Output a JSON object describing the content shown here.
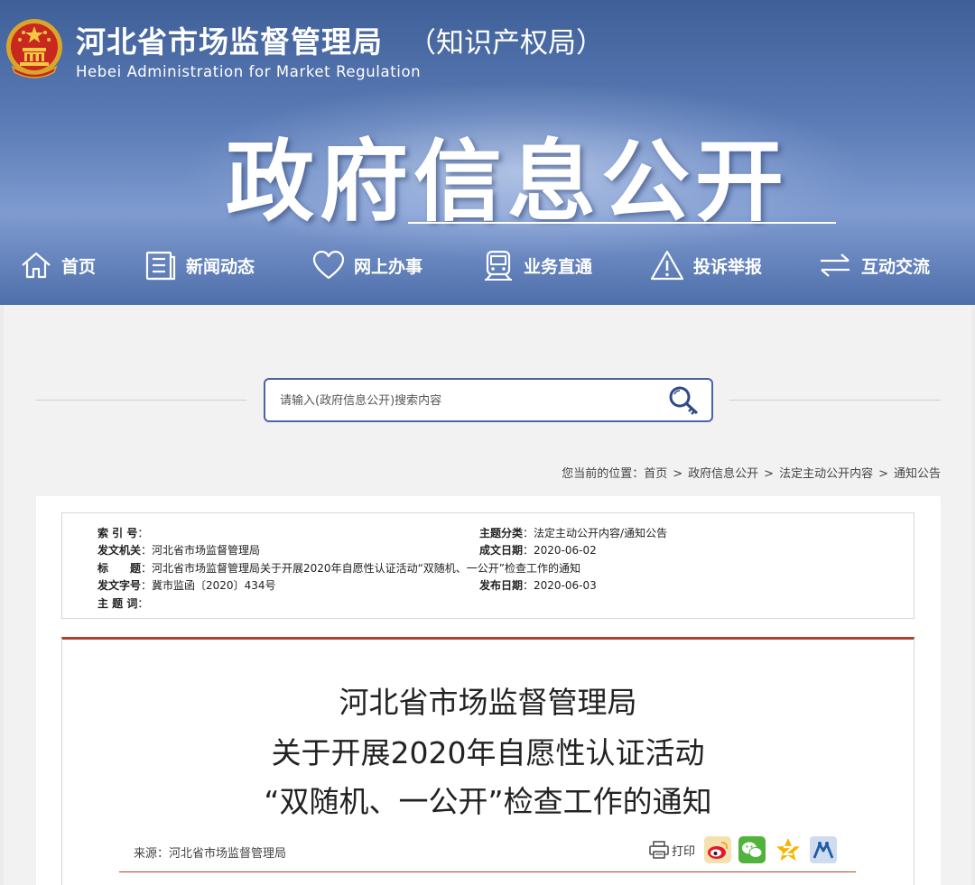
{
  "header": {
    "org_name": "河北省市场监督管理局",
    "org_sub": "（知识产权局）",
    "org_en": "Hebei Administration for Market Regulation",
    "banner_title": "政府信息公开"
  },
  "nav": [
    {
      "label": "首页",
      "icon": "home-icon"
    },
    {
      "label": "新闻动态",
      "icon": "news-icon"
    },
    {
      "label": "网上办事",
      "icon": "heart-icon"
    },
    {
      "label": "业务直通",
      "icon": "train-icon"
    },
    {
      "label": "投诉举报",
      "icon": "warning-icon"
    },
    {
      "label": "互动交流",
      "icon": "exchange-icon"
    }
  ],
  "search": {
    "placeholder": "请输入(政府信息公开)搜索内容",
    "value": ""
  },
  "breadcrumb": {
    "label": "您当前的位置：",
    "items": [
      "首页",
      "政府信息公开",
      "法定主动公开内容",
      "通知公告"
    ],
    "separator": ">"
  },
  "meta": {
    "index_no": {
      "label": "索 引 号",
      "value": ""
    },
    "category": {
      "label": "主题分类",
      "value": "法定主动公开内容/通知公告"
    },
    "issuer": {
      "label": "发文机关",
      "value": "河北省市场监督管理局"
    },
    "date_written": {
      "label": "成文日期",
      "value": "2020-06-02"
    },
    "title": {
      "label": "标　　题",
      "value": "河北省市场监督管理局关于开展2020年自愿性认证活动“双随机、一公开”检查工作的通知"
    },
    "doc_no": {
      "label": "发文字号",
      "value": "冀市监函〔2020〕434号"
    },
    "date_published": {
      "label": "发布日期",
      "value": "2020-06-03"
    },
    "keywords": {
      "label": "主 题 词",
      "value": ""
    }
  },
  "article": {
    "title_lines": [
      "河北省市场监督管理局",
      "关于开展2020年自愿性认证活动",
      "“双随机、一公开”检查工作的通知"
    ],
    "source_label": "来源：",
    "source_value": "河北省市场监督管理局",
    "print_label": "打印"
  },
  "share": [
    {
      "name": "weibo-icon"
    },
    {
      "name": "wechat-icon"
    },
    {
      "name": "qzone-icon"
    },
    {
      "name": "renren-icon"
    }
  ],
  "colors": {
    "header_blue": "#4f6fab",
    "search_border": "#4a64a4",
    "article_accent": "#b0402e"
  }
}
